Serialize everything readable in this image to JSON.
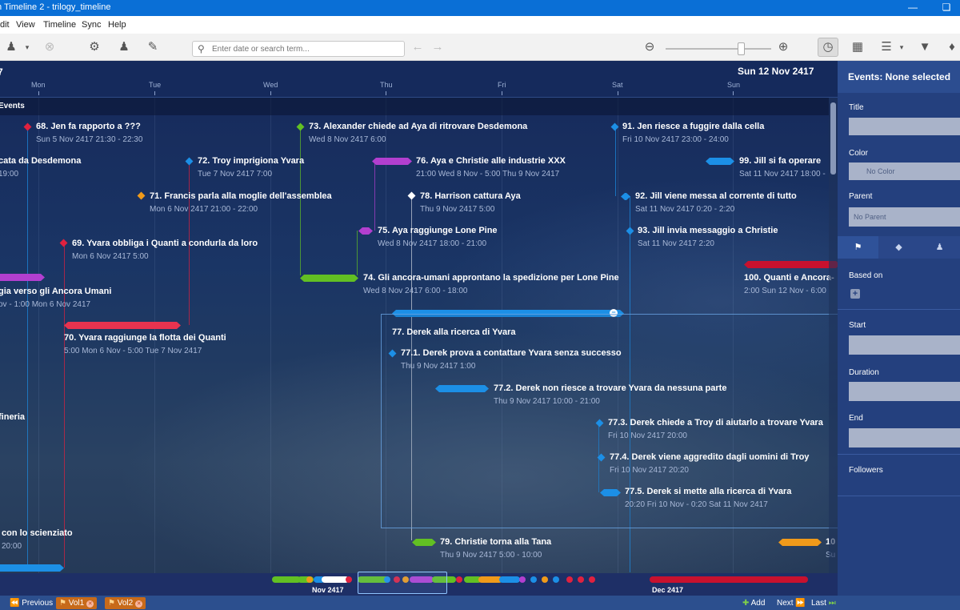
{
  "window": {
    "title": "n Timeline 2 - trilogy_timeline"
  },
  "menu": {
    "items": [
      "dit",
      "View",
      "Timeline",
      "Sync",
      "Help"
    ]
  },
  "toolbar": {
    "search_placeholder": "Enter date or search term..."
  },
  "ruler": {
    "year_label": "7",
    "current_date": "Sun 12 Nov 2417",
    "days": [
      "Mon",
      "Tue",
      "Wed",
      "Thu",
      "Fri",
      "Sat",
      "Sun"
    ]
  },
  "group": {
    "label": "Events"
  },
  "events": [
    {
      "title": "68. Jen fa rapporto a ???",
      "date": "Sun 5 Nov 2417 21:30 - 22:30",
      "color": "#e0213f"
    },
    {
      "title": "73. Alexander chiede ad Aya di ritrovare Desdemona",
      "date": "Wed 8 Nov 2417 6:00",
      "color": "#62c023"
    },
    {
      "title": "91. Jen riesce a fuggire dalla cella",
      "date": "Fri 10 Nov 2417 23:00 - 24:00",
      "color": "#1c8fe6"
    },
    {
      "title": "cata da Desdemona",
      "date": "19:00",
      "color": "#e0213f"
    },
    {
      "title": "72. Troy imprigiona Yvara",
      "date": "Tue 7 Nov 2417 7:00",
      "color": "#1c8fe6"
    },
    {
      "title": "76. Aya e Christie alle industrie XXX",
      "date": "21:00 Wed 8 Nov - 5:00 Thu 9 Nov 2417",
      "color": "#b23fcf"
    },
    {
      "title": "99. Jill si fa operare",
      "date": "Sat 11 Nov 2417 18:00 -",
      "color": "#1c8fe6"
    },
    {
      "title": "71. Francis parla alla moglie dell'assemblea",
      "date": "Mon 6 Nov 2417 21:00 - 22:00",
      "color": "#f09a1a"
    },
    {
      "title": "78. Harrison cattura Aya",
      "date": "Thu 9 Nov 2417 5:00",
      "color": "#ffffff"
    },
    {
      "title": "92. Jill viene messa al corrente di tutto",
      "date": "Sat 11 Nov 2417 0:20 - 2:20",
      "color": "#1c8fe6"
    },
    {
      "title": "75. Aya raggiunge Lone Pine",
      "date": "Wed 8 Nov 2417 18:00 - 21:00",
      "color": "#b23fcf"
    },
    {
      "title": "93. Jill invia messaggio a Christie",
      "date": "Sat 11 Nov 2417 2:20",
      "color": "#1c8fe6"
    },
    {
      "title": "69. Yvara obbliga i Quanti a condurla da loro",
      "date": "Mon 6 Nov 2417 5:00",
      "color": "#e0213f"
    },
    {
      "title": "74. Gli ancora-umani approntano la spedizione per Lone Pine",
      "date": "Wed 8 Nov 2417 6:00 - 18:00",
      "color": "#62c023"
    },
    {
      "title": "100. Quanti e Ancora-",
      "date": "2:00 Sun 12 Nov - 6:00",
      "color": "#e0213f"
    },
    {
      "title": "gia verso gli Ancora Umani",
      "date": "ov - 1:00 Mon 6 Nov 2417",
      "color": "#b23fcf"
    },
    {
      "title": "70. Yvara raggiunge la flotta dei Quanti",
      "date": "5:00 Mon 6 Nov - 5:00 Tue 7 Nov 2417",
      "color": "#e0213f"
    },
    {
      "title": "77. Derek alla ricerca di Yvara",
      "date": "",
      "color": "#1c8fe6"
    },
    {
      "title": "77.1. Derek prova a contattare Yvara senza successo",
      "date": "Thu 9 Nov 2417 1:00",
      "color": "#1c8fe6"
    },
    {
      "title": "77.2. Derek non riesce a trovare Yvara da nessuna parte",
      "date": "Thu 9 Nov 2417 10:00 - 21:00",
      "color": "#1c8fe6"
    },
    {
      "title": "77.3. Derek chiede a Troy di aiutarlo a trovare Yvara",
      "date": "Fri 10 Nov 2417 20:00",
      "color": "#1c8fe6"
    },
    {
      "title": "77.4. Derek viene aggredito dagli uomini di Troy",
      "date": "Fri 10 Nov 2417 20:20",
      "color": "#1c8fe6"
    },
    {
      "title": "77.5. Derek si mette alla ricerca di Yvara",
      "date": "20:20 Fri 10 Nov - 0:20 Sat 11 Nov 2417",
      "color": "#1c8fe6"
    },
    {
      "title": "fineria",
      "date": "",
      "color": "#1c8fe6"
    },
    {
      "title": "con lo scienziato",
      "date": "20:00",
      "color": "#1c8fe6"
    },
    {
      "title": "79. Christie torna alla Tana",
      "date": "Thu 9 Nov 2417 5:00 - 10:00",
      "color": "#62c023"
    },
    {
      "title": "10",
      "date": "Su",
      "color": "#f09a1a"
    }
  ],
  "overview": {
    "month_labels": [
      "Nov 2417",
      "Dec 2417"
    ]
  },
  "bottombar": {
    "previous_label": "Previous",
    "tabs": [
      "Vol1",
      "Vol2"
    ],
    "add_label": "Add",
    "next_label": "Next",
    "last_label": "Last"
  },
  "panel": {
    "header": "Events: None selected",
    "title_label": "Title",
    "color_label": "Color",
    "color_value": "No Color",
    "parent_label": "Parent",
    "parent_value": "No Parent",
    "based_on_label": "Based on",
    "start_label": "Start",
    "duration_label": "Duration",
    "end_label": "End",
    "followers_label": "Followers"
  }
}
